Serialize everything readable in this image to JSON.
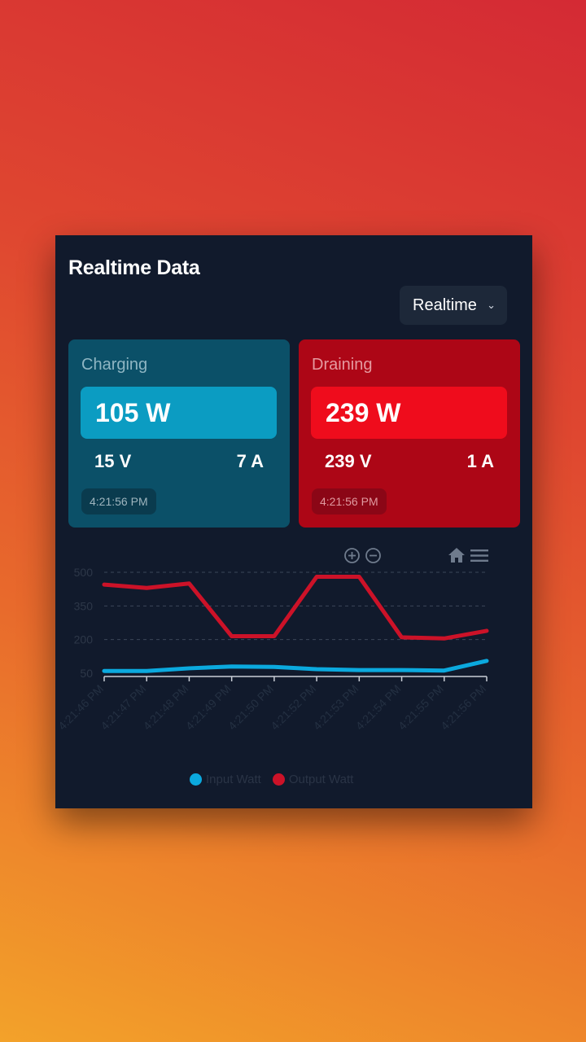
{
  "header": {
    "title": "Realtime Data"
  },
  "range_select": {
    "value": "Realtime",
    "chevron": "⌄"
  },
  "charging": {
    "label": "Charging",
    "watt": "105 W",
    "volt": "15 V",
    "amp": "7 A",
    "time": "4:21:56 PM"
  },
  "draining": {
    "label": "Draining",
    "watt": "239 W",
    "volt": "239 V",
    "amp": "1 A",
    "time": "4:21:56 PM"
  },
  "toolbar": {
    "icons": [
      "zoom-in-icon",
      "zoom-out-icon",
      "home-icon",
      "menu-icon"
    ]
  },
  "colors": {
    "input": "#0ba9de",
    "output": "#cc1228",
    "grid": "#3b4558",
    "axis_text": "#2d3748",
    "tick_text": "#243042"
  },
  "chart_data": {
    "type": "line",
    "x": [
      "4:21:46 PM",
      "4:21:47 PM",
      "4:21:48 PM",
      "4:21:49 PM",
      "4:21:50 PM",
      "4:21:52 PM",
      "4:21:53 PM",
      "4:21:54 PM",
      "4:21:55 PM",
      "4:21:56 PM"
    ],
    "series": [
      {
        "name": "Input Watt",
        "color": "#0ba9de",
        "values": [
          60,
          60,
          72,
          80,
          78,
          68,
          64,
          64,
          62,
          105
        ]
      },
      {
        "name": "Output Watt",
        "color": "#cc1228",
        "values": [
          445,
          430,
          450,
          215,
          215,
          480,
          480,
          210,
          205,
          239
        ]
      }
    ],
    "y_ticks": [
      "500",
      "350",
      "200",
      "50"
    ],
    "ylim": [
      50,
      500
    ],
    "grid": true,
    "legend": "bottom"
  }
}
